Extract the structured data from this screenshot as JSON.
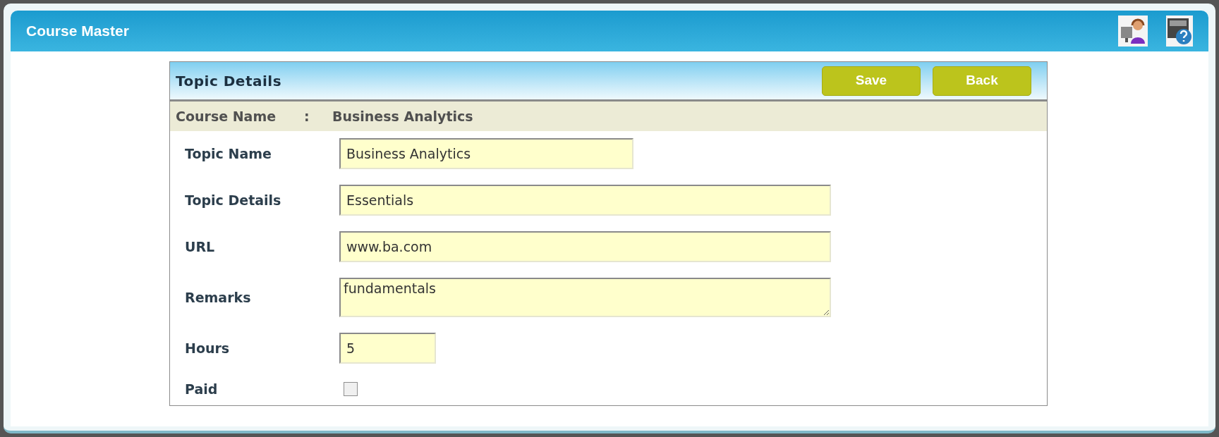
{
  "window": {
    "title": "Course Master"
  },
  "panel": {
    "title": "Topic Details",
    "buttons": [
      "Save",
      "Back"
    ],
    "course_name": {
      "label": "Course Name",
      "separator": ":",
      "value": "Business Analytics"
    }
  },
  "fields": [
    {
      "kind": "text",
      "label": "Topic Name",
      "value": "Business Analytics"
    },
    {
      "kind": "text",
      "label": "Topic Details",
      "value": "Essentials"
    },
    {
      "kind": "text",
      "label": "URL",
      "value": "www.ba.com"
    },
    {
      "kind": "textarea",
      "label": "Remarks",
      "value": "fundamentals"
    },
    {
      "kind": "text",
      "label": "Hours",
      "value": "5"
    },
    {
      "kind": "checkbox",
      "label": "Paid",
      "checked": false
    }
  ]
}
